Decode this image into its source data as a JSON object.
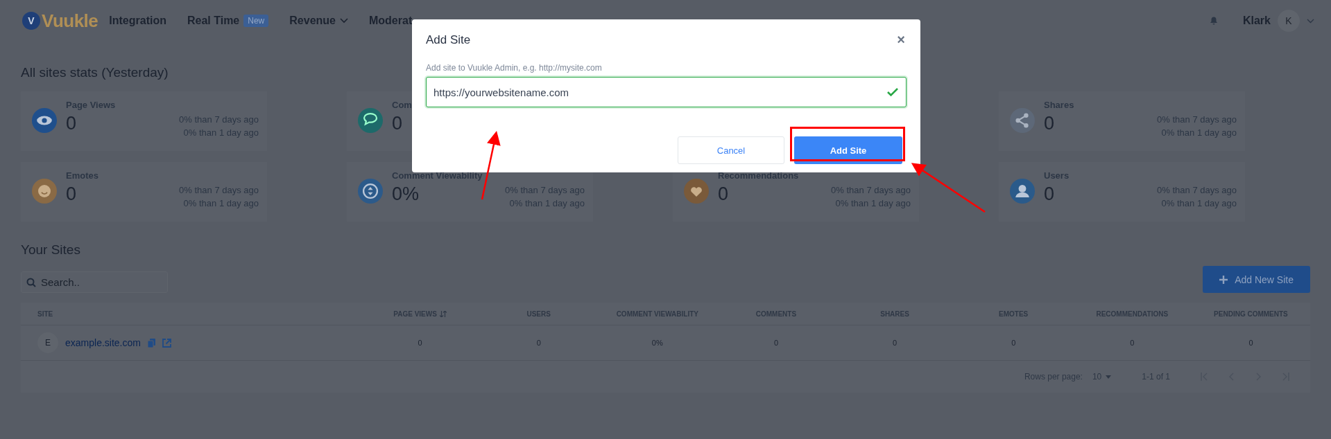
{
  "nav": {
    "logo": "Vuukle",
    "logo_mark": "V",
    "items": [
      {
        "label": "Integration",
        "dropdown": false
      },
      {
        "label": "Real Time",
        "badge": "New",
        "dropdown": false
      },
      {
        "label": "Revenue",
        "dropdown": true
      },
      {
        "label": "Moderat",
        "dropdown": false
      }
    ],
    "user": {
      "name": "Klark",
      "initial": "K"
    }
  },
  "stats": {
    "title": "All sites stats (Yesterday)",
    "cards": [
      {
        "kind": "stat",
        "color": "#1f4f8c",
        "label": "Page Views",
        "value": "0",
        "week": "0% than 7 days ago",
        "day": "0% than 1 day ago"
      },
      {
        "kind": "stat",
        "color": "#1d6a6a",
        "label": "Com",
        "value": "0"
      },
      {
        "kind": "hidden"
      },
      {
        "kind": "stat",
        "color": "#5d6878",
        "label": "Shares",
        "value": "0",
        "week": "0% than 7 days ago",
        "day": "0% than 1 day ago"
      },
      {
        "kind": "stat",
        "color": "#8a6a45",
        "label": "Emotes",
        "value": "0",
        "week": "0% than 7 days ago",
        "day": "0% than 1 day ago"
      },
      {
        "kind": "stat",
        "color": "#2c5a8a",
        "label": "Comment Viewability",
        "value": "0%",
        "week": "0% than 7 days ago",
        "day": "0% than 1 day ago"
      },
      {
        "kind": "stat",
        "color": "#7a5a3a",
        "label": "Recommendations",
        "value": "0",
        "week": "0% than 7 days ago",
        "day": "0% than 1 day ago"
      },
      {
        "kind": "stat",
        "color": "#2a5a8a",
        "label": "Users",
        "value": "0",
        "week": "0% than 7 days ago",
        "day": "0% than 1 day ago"
      }
    ]
  },
  "sites": {
    "title": "Your Sites",
    "search": {
      "placeholder": "Search.."
    },
    "add_button": "Add New Site",
    "table": {
      "columns": [
        "SITE",
        "PAGE VIEWS",
        "USERS",
        "COMMENT VIEWABILITY",
        "COMMENTS",
        "SHARES",
        "EMOTES",
        "RECOMMENDATIONS",
        "PENDING COMMENTS"
      ],
      "rows": [
        {
          "initial": "E",
          "cells": [
            "example.site.com",
            "0",
            "0",
            "0%",
            "0",
            "0",
            "0",
            "0",
            "0"
          ]
        }
      ]
    },
    "footer": {
      "rows_label": "Rows per page:",
      "rows_value": "10",
      "range": "1-1 of 1"
    }
  },
  "modal": {
    "title": "Add Site",
    "close": "×",
    "label": "Add site to Vuukle Admin, e.g. http://mysite.com",
    "value": "https://yourwebsitename.com",
    "valid": true,
    "cancel": "Cancel",
    "submit": "Add Site"
  }
}
